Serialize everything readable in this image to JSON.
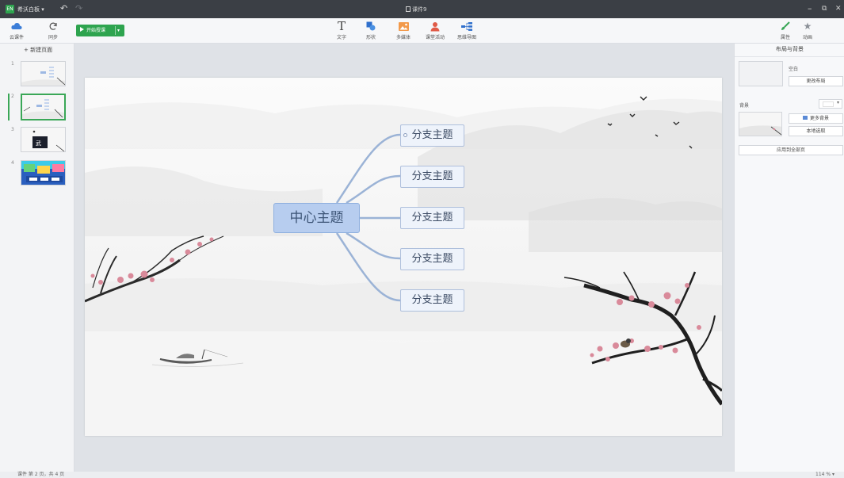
{
  "titlebar": {
    "app_name": "希沃白板 ▾",
    "doc_title": "课件9",
    "undo_glyph": "↶",
    "redo_glyph": "↷",
    "minimize_glyph": "–",
    "restore_glyph": "⧉",
    "close_glyph": "✕"
  },
  "toolbar": {
    "cloud_label": "云课件",
    "sync_label": "同步",
    "start_label": "开始授课",
    "start_dropdown": "▾",
    "text_label": "文字",
    "shape_label": "形状",
    "media_label": "多媒体",
    "activity_label": "课堂活动",
    "mindmap_label": "思维导图",
    "properties_label": "属性",
    "animation_label": "动画"
  },
  "slide_panel": {
    "new_page_label": "+ 新建页面",
    "slides": [
      {
        "num": "1"
      },
      {
        "num": "2"
      },
      {
        "num": "3"
      },
      {
        "num": "4"
      }
    ],
    "active_index": 2
  },
  "mindmap": {
    "center": "中心主题",
    "branches": [
      "分支主题",
      "分支主题",
      "分支主题",
      "分支主题",
      "分支主题"
    ],
    "colors": {
      "center_fill": "#b7cdef",
      "branch_fill": "#eef3fb",
      "connector": "#9bb3d6"
    }
  },
  "right_panel": {
    "title": "布局与背景",
    "layout_name": "空白",
    "change_layout": "更改布局",
    "background_label": "背景",
    "more_backgrounds": "更多背景",
    "local_pick": "本地选取",
    "apply_all": "应用到全部页"
  },
  "status": {
    "page_info": "课件 第 2 页，共 4 页",
    "zoom": "114 % ▾"
  },
  "colors": {
    "accent_green": "#2ea44f",
    "titlebar_bg": "#3b3f45"
  }
}
